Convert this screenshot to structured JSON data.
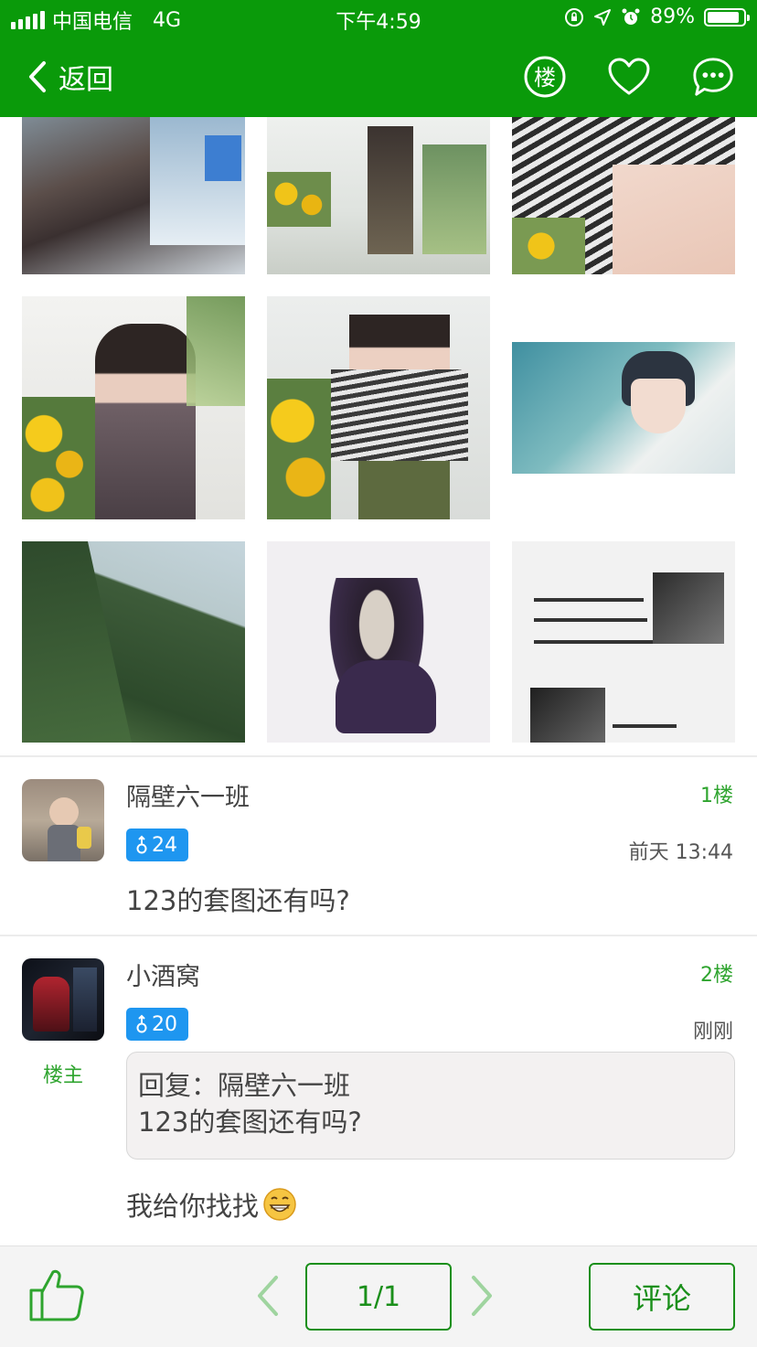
{
  "status_bar": {
    "carrier": "中国电信",
    "network": "4G",
    "time": "下午4:59",
    "battery": "89%",
    "battery_level": 0.89
  },
  "nav": {
    "back_label": "返回",
    "floor_icon_label": "楼",
    "icons": [
      "floor-icon",
      "heart-icon",
      "chat-icon"
    ]
  },
  "images": [
    "plaid-shirt-photo",
    "sunflower-room-photo",
    "striped-shirt-closeup",
    "plaid-portrait-photo",
    "striped-shirt-portrait",
    "anime-boy-illustration",
    "green-hillside-photo",
    "opera-villain-illustration",
    "couple-quote-card"
  ],
  "posts": [
    {
      "username": "隔壁六一班",
      "floor": "1楼",
      "level": "24",
      "time": "前天 13:44",
      "content": "123的套图还有吗?"
    },
    {
      "username": "小酒窝",
      "floor": "2楼",
      "level": "20",
      "time": "刚刚",
      "owner_label": "楼主",
      "quote_line1": "回复：隔壁六一班",
      "quote_line2": "123的套图还有吗?",
      "content": "我给你找找",
      "emoji": "grin-emoji"
    }
  ],
  "toolbar": {
    "page": "1/1",
    "comment_label": "评论"
  },
  "colors": {
    "brand_green": "#0a9a0a",
    "accent_green": "#2ea42e",
    "badge_blue": "#1e96f0"
  }
}
